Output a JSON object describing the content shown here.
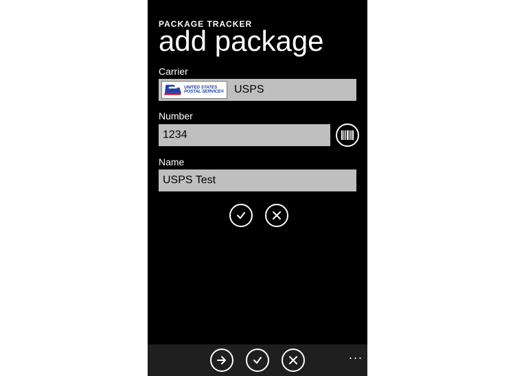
{
  "header": {
    "app_title": "PACKAGE TRACKER",
    "page_title": "add package"
  },
  "fields": {
    "carrier": {
      "label": "Carrier",
      "value": "USPS",
      "logo_line1": "UNITED STATES",
      "logo_line2": "POSTAL SERVICE®"
    },
    "number": {
      "label": "Number",
      "value": "1234"
    },
    "name": {
      "label": "Name",
      "value": "USPS Test"
    }
  },
  "icons": {
    "barcode": "barcode",
    "accept": "check",
    "cancel": "cross",
    "next": "arrow-right",
    "more": "..."
  }
}
